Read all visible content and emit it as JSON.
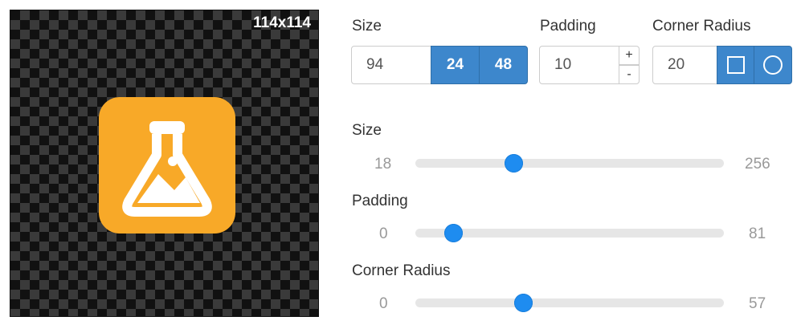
{
  "preview": {
    "dimensions": "114x114",
    "icon": "flask-image-icon",
    "tile_color": "#f8a928"
  },
  "top_controls": {
    "size_label": "Size",
    "size_value": "94",
    "size_preset_1": "24",
    "size_preset_2": "48",
    "padding_label": "Padding",
    "padding_value": "10",
    "padding_plus": "+",
    "padding_minus": "-",
    "corner_label": "Corner Radius",
    "corner_value": "20",
    "corner_square_icon": "square-icon",
    "corner_circle_icon": "circle-icon"
  },
  "sliders": [
    {
      "label": "Size",
      "min": "18",
      "max": "256",
      "value": 94
    },
    {
      "label": "Padding",
      "min": "0",
      "max": "81",
      "value": 10
    },
    {
      "label": "Corner Radius",
      "min": "0",
      "max": "57",
      "value": 20
    }
  ],
  "colors": {
    "accent": "#3d87cc",
    "slider_thumb": "#1e8cf0",
    "track": "#e6e6e6"
  }
}
